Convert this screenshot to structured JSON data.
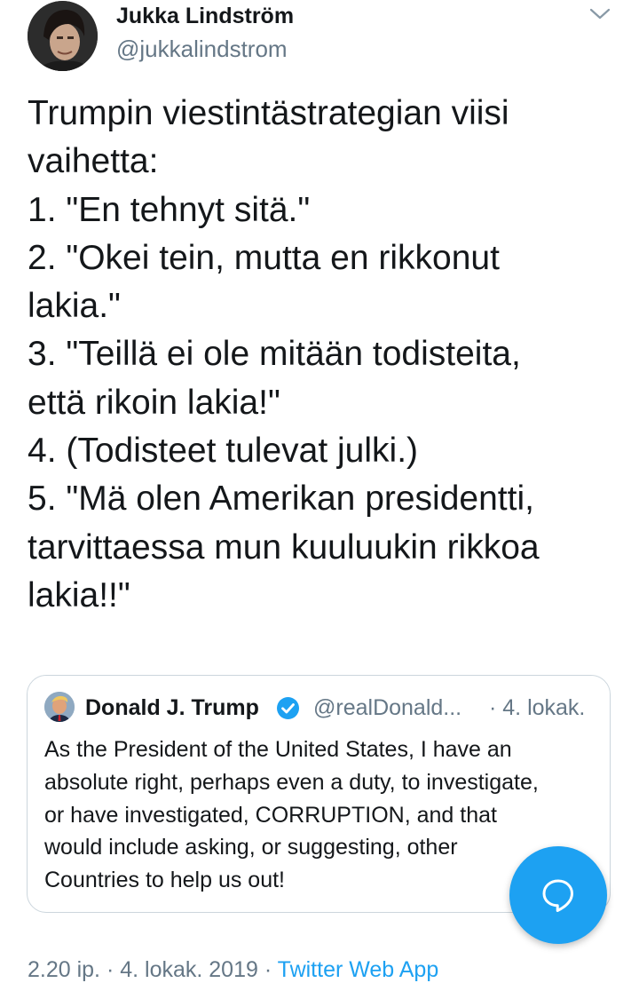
{
  "author": {
    "name": "Jukka Lindström",
    "handle": "@jukkalindstrom"
  },
  "tweet": {
    "lines": [
      "Trumpin viestintästrategian viisi",
      "vaihetta:",
      "1. \"En tehnyt sitä.\"",
      "2. \"Okei tein, mutta en rikkonut",
      "lakia.\"",
      "3. \"Teillä ei ole mitään todisteita,",
      "että rikoin lakia!\"",
      "4. (Todisteet tulevat julki.)",
      "5. \"Mä olen Amerikan presidentti,",
      "tarvittaessa mun kuuluukin rikkoa",
      "lakia!!\""
    ]
  },
  "quoted_tweet": {
    "name": "Donald J. Trump",
    "handle": "@realDonald...",
    "date": "· 4. lokak.",
    "lines": [
      "As the President of the United States, I have an",
      "absolute right, perhaps even a duty, to investigate,",
      "or have investigated, CORRUPTION, and that",
      "would include asking, or suggesting, other",
      "Countries to help us out!"
    ]
  },
  "meta": {
    "time": "2.20 ip.",
    "separator1": " · ",
    "date": "4. lokak. 2019",
    "separator2": " · ",
    "app": "Twitter Web App"
  },
  "colors": {
    "accent": "#1da1f2",
    "secondary_text": "#657786",
    "border": "#ccd6dd"
  },
  "icons": {
    "menu": "chevron-down-icon",
    "verified": "verified-badge-icon",
    "compose": "chat-bubble-icon"
  }
}
